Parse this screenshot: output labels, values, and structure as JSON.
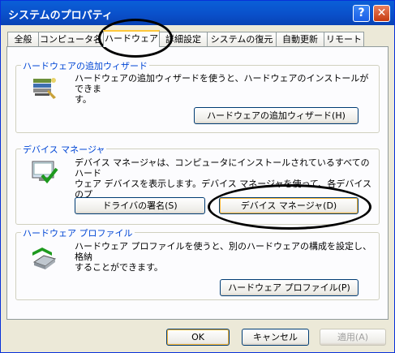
{
  "window": {
    "title": "システムのプロパティ",
    "help_label": "?",
    "close_label": "✕"
  },
  "tabs": [
    {
      "label": "全般"
    },
    {
      "label": "コンピュータ名"
    },
    {
      "label": "ハードウェア"
    },
    {
      "label": "詳細設定"
    },
    {
      "label": "システムの復元"
    },
    {
      "label": "自動更新"
    },
    {
      "label": "リモート"
    }
  ],
  "active_tab": "ハードウェア",
  "groups": {
    "wizard": {
      "title": "ハードウェアの追加ウィザード",
      "description": "ハードウェアの追加ウィザードを使うと、ハードウェアのインストールができま\nす。",
      "button": "ハードウェアの追加ウィザード(H)",
      "icon": "hardware-wizard-icon"
    },
    "device_manager": {
      "title": "デバイス マネージャ",
      "description": "デバイス マネージャは、コンピュータにインストールされているすべてのハード\nウェア デバイスを表示します。デバイス マネージャを使って、各デバイスのプ\nロパティを変更できます。",
      "button_driver": "ドライバの署名(S)",
      "button_manager": "デバイス マネージャ(D)",
      "icon": "device-manager-icon"
    },
    "profiles": {
      "title": "ハードウェア プロファイル",
      "description": "ハードウェア プロファイルを使うと、別のハードウェアの構成を設定し、格納\nすることができます。",
      "button": "ハードウェア プロファイル(P)",
      "icon": "hardware-profile-icon"
    }
  },
  "footer": {
    "ok": "OK",
    "cancel": "キャンセル",
    "apply": "適用(A)"
  },
  "colors": {
    "accent": "#0046d5",
    "titlebar": "#0a5fd8",
    "annotation": "#000000"
  }
}
